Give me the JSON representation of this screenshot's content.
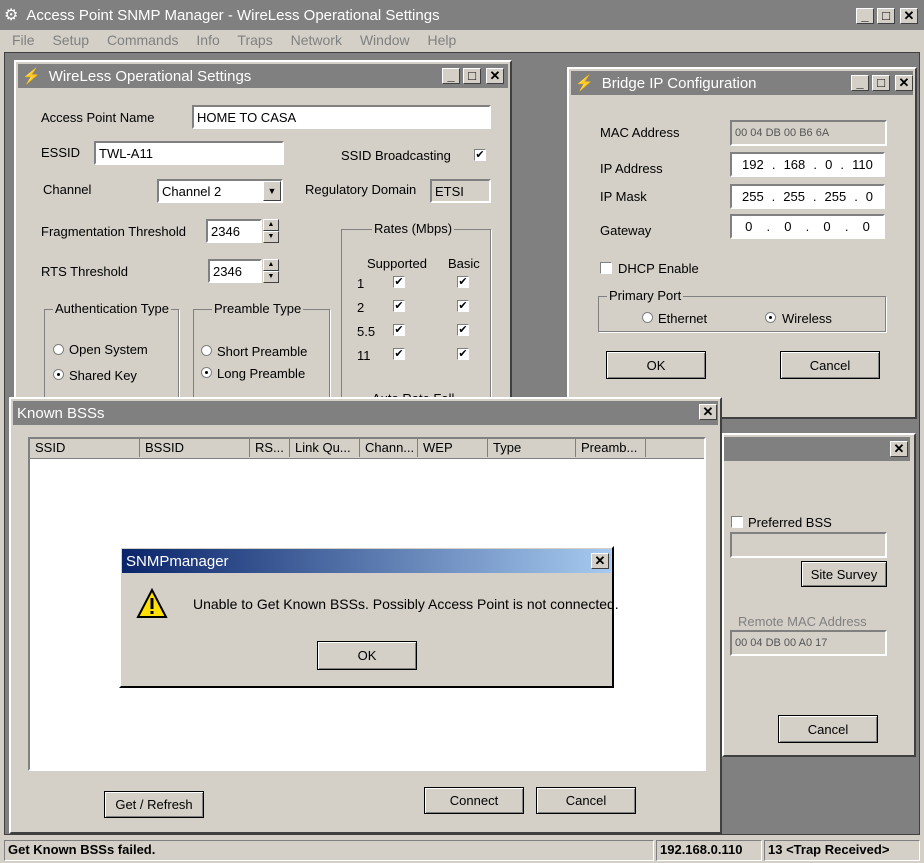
{
  "app": {
    "title": "Access Point SNMP Manager -  WireLess Operational Settings",
    "menu": [
      "File",
      "Setup",
      "Commands",
      "Info",
      "Traps",
      "Network",
      "Window",
      "Help"
    ]
  },
  "wos": {
    "title": "WireLess Operational Settings",
    "ap_name_label": "Access Point Name",
    "ap_name": "HOME TO CASA",
    "essid_label": "ESSID",
    "essid": "TWL-A11",
    "ssid_broadcast_label": "SSID Broadcasting",
    "ssid_broadcast_checked": true,
    "channel_label": "Channel",
    "channel": "Channel 2",
    "reg_domain_label": "Regulatory Domain",
    "reg_domain": "ETSI",
    "frag_label": "Fragmentation Threshold",
    "frag": "2346",
    "rts_label": "RTS Threshold",
    "rts": "2346",
    "rates_title": "Rates (Mbps)",
    "supported_label": "Supported",
    "basic_label": "Basic",
    "rates": [
      "1",
      "2",
      "5.5",
      "11"
    ],
    "auth_title": "Authentication Type",
    "auth_open": "Open System",
    "auth_shared": "Shared Key",
    "preamble_title": "Preamble Type",
    "pre_short": "Short Preamble",
    "pre_long": "Long Preamble",
    "auto_rate_partial": "Auto Rate Fall"
  },
  "bip": {
    "title": "Bridge IP Configuration",
    "mac_label": "MAC Address",
    "mac": "00 04 DB 00 B6 6A",
    "ip_label": "IP Address",
    "ip": [
      "192",
      "168",
      "0",
      "110"
    ],
    "mask_label": "IP Mask",
    "mask": [
      "255",
      "255",
      "255",
      "0"
    ],
    "gw_label": "Gateway",
    "gw": [
      "0",
      "0",
      "0",
      "0"
    ],
    "dhcp_label": "DHCP Enable",
    "primary_port_title": "Primary Port",
    "ethernet": "Ethernet",
    "wireless": "Wireless",
    "ok": "OK",
    "cancel": "Cancel"
  },
  "third": {
    "preferred_bss": "Preferred BSS",
    "site_survey": "Site Survey",
    "remote_mac_label": "Remote MAC Address",
    "remote_mac": "00 04 DB 00 A0 17",
    "cancel": "Cancel"
  },
  "kbss": {
    "title": "Known BSSs",
    "columns": [
      "SSID",
      "BSSID",
      "RS...",
      "Link Qu...",
      "Chann...",
      "WEP",
      "Type",
      "Preamb..."
    ],
    "refresh": "Get / Refresh",
    "connect": "Connect",
    "cancel": "Cancel"
  },
  "dialog": {
    "title": "SNMPmanager",
    "message": "Unable to Get Known BSSs. Possibly Access Point is not connected.",
    "ok": "OK"
  },
  "status": {
    "message": "Get Known BSSs failed.",
    "ip": "192.168.0.110",
    "traps": "13 <Trap Received>"
  }
}
